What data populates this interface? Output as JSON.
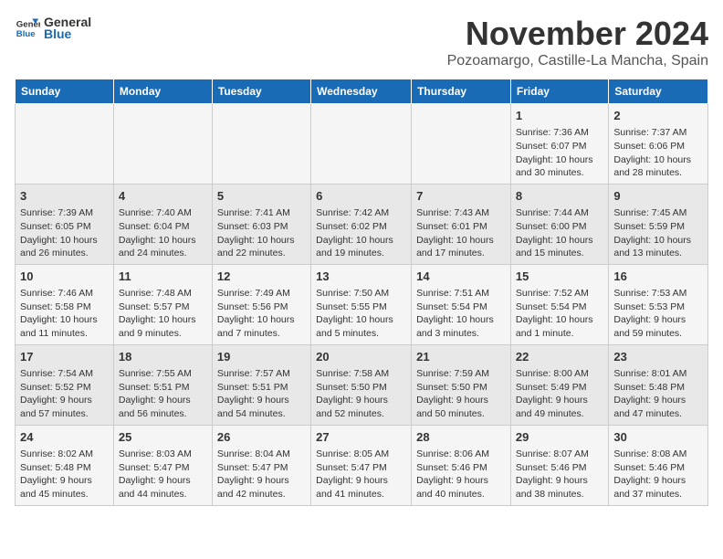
{
  "logo": {
    "general": "General",
    "blue": "Blue"
  },
  "header": {
    "month": "November 2024",
    "location": "Pozoamargo, Castille-La Mancha, Spain"
  },
  "weekdays": [
    "Sunday",
    "Monday",
    "Tuesday",
    "Wednesday",
    "Thursday",
    "Friday",
    "Saturday"
  ],
  "weeks": [
    [
      {
        "day": "",
        "info": ""
      },
      {
        "day": "",
        "info": ""
      },
      {
        "day": "",
        "info": ""
      },
      {
        "day": "",
        "info": ""
      },
      {
        "day": "",
        "info": ""
      },
      {
        "day": "1",
        "info": "Sunrise: 7:36 AM\nSunset: 6:07 PM\nDaylight: 10 hours and 30 minutes."
      },
      {
        "day": "2",
        "info": "Sunrise: 7:37 AM\nSunset: 6:06 PM\nDaylight: 10 hours and 28 minutes."
      }
    ],
    [
      {
        "day": "3",
        "info": "Sunrise: 7:39 AM\nSunset: 6:05 PM\nDaylight: 10 hours and 26 minutes."
      },
      {
        "day": "4",
        "info": "Sunrise: 7:40 AM\nSunset: 6:04 PM\nDaylight: 10 hours and 24 minutes."
      },
      {
        "day": "5",
        "info": "Sunrise: 7:41 AM\nSunset: 6:03 PM\nDaylight: 10 hours and 22 minutes."
      },
      {
        "day": "6",
        "info": "Sunrise: 7:42 AM\nSunset: 6:02 PM\nDaylight: 10 hours and 19 minutes."
      },
      {
        "day": "7",
        "info": "Sunrise: 7:43 AM\nSunset: 6:01 PM\nDaylight: 10 hours and 17 minutes."
      },
      {
        "day": "8",
        "info": "Sunrise: 7:44 AM\nSunset: 6:00 PM\nDaylight: 10 hours and 15 minutes."
      },
      {
        "day": "9",
        "info": "Sunrise: 7:45 AM\nSunset: 5:59 PM\nDaylight: 10 hours and 13 minutes."
      }
    ],
    [
      {
        "day": "10",
        "info": "Sunrise: 7:46 AM\nSunset: 5:58 PM\nDaylight: 10 hours and 11 minutes."
      },
      {
        "day": "11",
        "info": "Sunrise: 7:48 AM\nSunset: 5:57 PM\nDaylight: 10 hours and 9 minutes."
      },
      {
        "day": "12",
        "info": "Sunrise: 7:49 AM\nSunset: 5:56 PM\nDaylight: 10 hours and 7 minutes."
      },
      {
        "day": "13",
        "info": "Sunrise: 7:50 AM\nSunset: 5:55 PM\nDaylight: 10 hours and 5 minutes."
      },
      {
        "day": "14",
        "info": "Sunrise: 7:51 AM\nSunset: 5:54 PM\nDaylight: 10 hours and 3 minutes."
      },
      {
        "day": "15",
        "info": "Sunrise: 7:52 AM\nSunset: 5:54 PM\nDaylight: 10 hours and 1 minute."
      },
      {
        "day": "16",
        "info": "Sunrise: 7:53 AM\nSunset: 5:53 PM\nDaylight: 9 hours and 59 minutes."
      }
    ],
    [
      {
        "day": "17",
        "info": "Sunrise: 7:54 AM\nSunset: 5:52 PM\nDaylight: 9 hours and 57 minutes."
      },
      {
        "day": "18",
        "info": "Sunrise: 7:55 AM\nSunset: 5:51 PM\nDaylight: 9 hours and 56 minutes."
      },
      {
        "day": "19",
        "info": "Sunrise: 7:57 AM\nSunset: 5:51 PM\nDaylight: 9 hours and 54 minutes."
      },
      {
        "day": "20",
        "info": "Sunrise: 7:58 AM\nSunset: 5:50 PM\nDaylight: 9 hours and 52 minutes."
      },
      {
        "day": "21",
        "info": "Sunrise: 7:59 AM\nSunset: 5:50 PM\nDaylight: 9 hours and 50 minutes."
      },
      {
        "day": "22",
        "info": "Sunrise: 8:00 AM\nSunset: 5:49 PM\nDaylight: 9 hours and 49 minutes."
      },
      {
        "day": "23",
        "info": "Sunrise: 8:01 AM\nSunset: 5:48 PM\nDaylight: 9 hours and 47 minutes."
      }
    ],
    [
      {
        "day": "24",
        "info": "Sunrise: 8:02 AM\nSunset: 5:48 PM\nDaylight: 9 hours and 45 minutes."
      },
      {
        "day": "25",
        "info": "Sunrise: 8:03 AM\nSunset: 5:47 PM\nDaylight: 9 hours and 44 minutes."
      },
      {
        "day": "26",
        "info": "Sunrise: 8:04 AM\nSunset: 5:47 PM\nDaylight: 9 hours and 42 minutes."
      },
      {
        "day": "27",
        "info": "Sunrise: 8:05 AM\nSunset: 5:47 PM\nDaylight: 9 hours and 41 minutes."
      },
      {
        "day": "28",
        "info": "Sunrise: 8:06 AM\nSunset: 5:46 PM\nDaylight: 9 hours and 40 minutes."
      },
      {
        "day": "29",
        "info": "Sunrise: 8:07 AM\nSunset: 5:46 PM\nDaylight: 9 hours and 38 minutes."
      },
      {
        "day": "30",
        "info": "Sunrise: 8:08 AM\nSunset: 5:46 PM\nDaylight: 9 hours and 37 minutes."
      }
    ]
  ]
}
